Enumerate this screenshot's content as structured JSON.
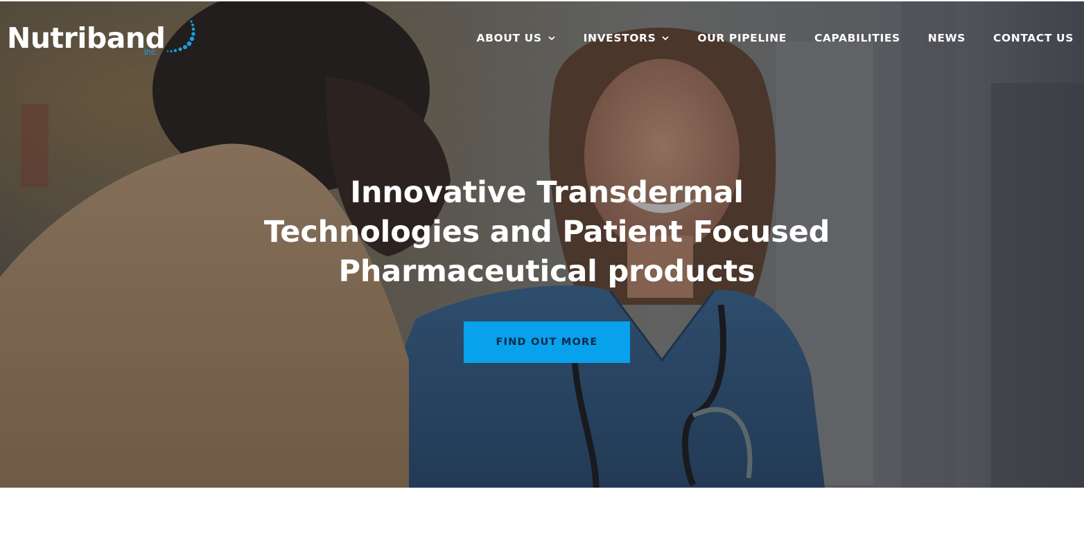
{
  "brand": {
    "name": "Nutriband",
    "suffix": "inc.",
    "accent_color": "#1aa0e8"
  },
  "nav": {
    "items": [
      {
        "label": "ABOUT US",
        "has_dropdown": true
      },
      {
        "label": "INVESTORS",
        "has_dropdown": true
      },
      {
        "label": "OUR PIPELINE",
        "has_dropdown": false
      },
      {
        "label": "CAPABILITIES",
        "has_dropdown": false
      },
      {
        "label": "NEWS",
        "has_dropdown": false
      },
      {
        "label": "CONTACT US",
        "has_dropdown": false
      }
    ]
  },
  "hero": {
    "headline_lines": [
      "Innovative Transdermal",
      "Technologies and Patient Focused",
      "Pharmaceutical products"
    ],
    "cta_label": "FIND OUT MORE",
    "cta_color": "#08a1ec",
    "image": "photo of a smiling healthcare worker in blue scrubs with a stethoscope talking to a patient"
  }
}
